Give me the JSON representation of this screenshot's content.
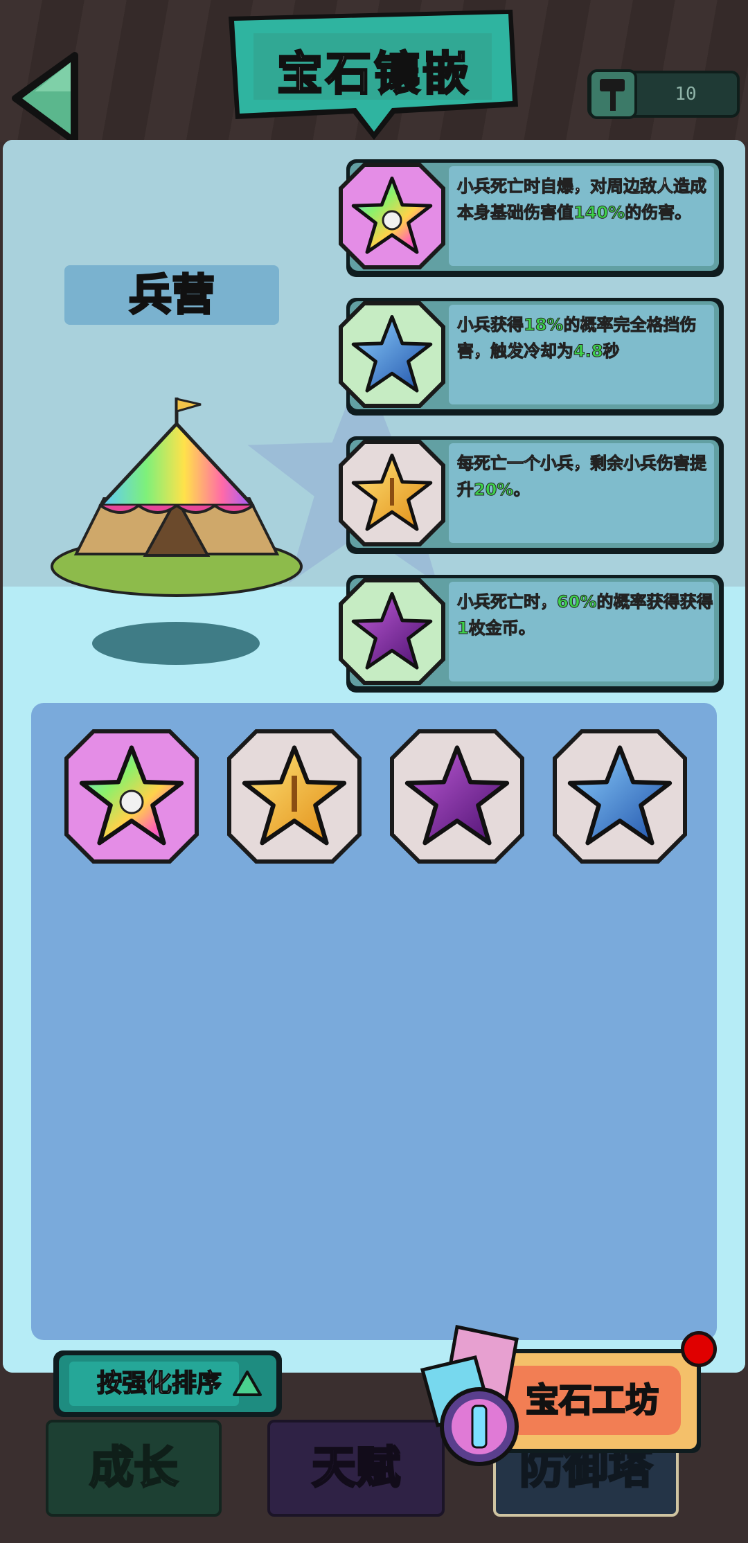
{
  "header": {
    "title": "宝石镶嵌",
    "hammer_count": "10"
  },
  "building": {
    "name": "兵营"
  },
  "effects": [
    {
      "gem": "rainbow-skull-star",
      "frame": "pink",
      "parts": [
        "小兵死亡时自爆，对周边敌人造成本身基础伤害值",
        "140%",
        "的伤害。"
      ]
    },
    {
      "gem": "blue-crystal-star",
      "frame": "green",
      "parts": [
        "小兵获得",
        "18%",
        "的概率完全格挡伤害，触发冷却为",
        "4.8",
        "秒"
      ]
    },
    {
      "gem": "gold-sword-star",
      "frame": "grey",
      "parts": [
        "每死亡一个小兵，剩余小兵伤害提升",
        "20%",
        "。"
      ]
    },
    {
      "gem": "purple-recycle-star",
      "frame": "green",
      "parts": [
        "小兵死亡时，",
        "60%",
        "的概率获得获得",
        "1",
        "枚金币。"
      ]
    }
  ],
  "inventory": [
    {
      "gem": "rainbow-skull-star"
    },
    {
      "gem": "gold-sword-star"
    },
    {
      "gem": "purple-recycle-star"
    },
    {
      "gem": "blue-crystal-star"
    }
  ],
  "sort_button": {
    "label": "按强化排序"
  },
  "tabs": {
    "growth": "成长",
    "talent": "天赋",
    "tower": "防御塔"
  },
  "workshop": {
    "label": "宝石工坊"
  },
  "colors": {
    "highlight": "#3dd24a",
    "panel": "#a9d1dc",
    "inventory_bg": "#7aaadb",
    "teal_accent": "#25a798"
  }
}
